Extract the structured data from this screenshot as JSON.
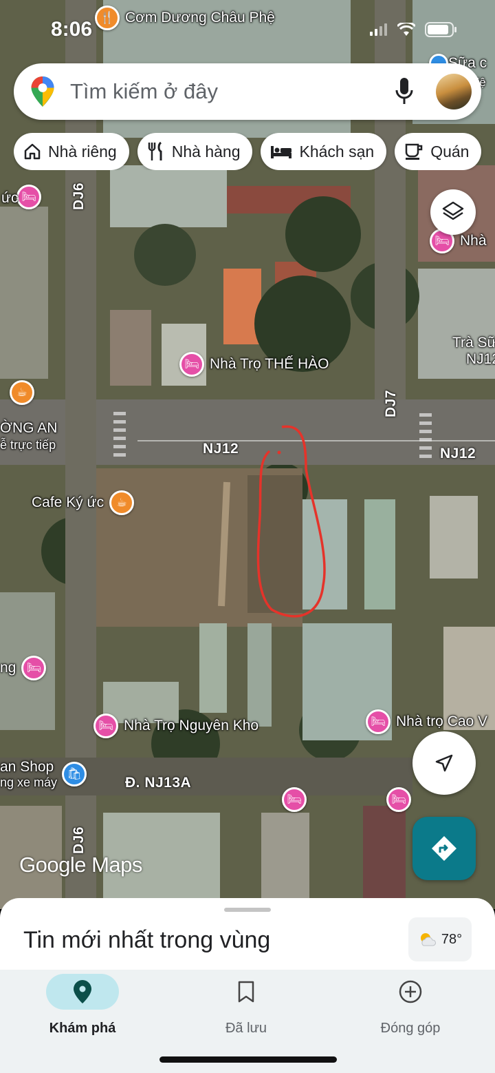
{
  "status_bar": {
    "time": "8:06"
  },
  "search": {
    "placeholder": "Tìm kiếm ở đây"
  },
  "chips": [
    {
      "label": "Nhà riêng",
      "icon": "home-icon"
    },
    {
      "label": "Nhà hàng",
      "icon": "restaurant-icon"
    },
    {
      "label": "Khách sạn",
      "icon": "hotel-icon"
    },
    {
      "label": "Quán",
      "icon": "cafe-icon"
    }
  ],
  "map": {
    "roads": {
      "dj6_top": "DJ6",
      "dj6_bottom": "DJ6",
      "dj7": "DJ7",
      "nj12_left": "NJ12",
      "nj12_right": "NJ12",
      "nj13a": "Đ. NJ13A"
    },
    "pois": {
      "top": "Cơm Dương Châu Phệ",
      "top_right": "Sữa c",
      "top_right_2": "hiệ",
      "left_hotel_1": "ức",
      "right_hotel_1": "Nhà",
      "the_hao": "Nhà Trọ THẾ HÀO",
      "tra_sua": "Trà Sữ",
      "tra_sua_2": "NJ12",
      "left_cafe_1": "ỜNG AN",
      "left_cafe_2": "ễ trực tiếp",
      "cafe_ky_uc": "Cafe Ký ức",
      "left_hotel_2": "ng",
      "nguyen_kho": "Nhà Trọ Nguyên Kho",
      "cao_v": "Nhà trọ Cao V",
      "shop_1": "an Shop",
      "shop_2": "ng xe máy"
    },
    "logo": {
      "google": "Google",
      "maps": "Maps"
    }
  },
  "sheet": {
    "title": "Tin mới nhất trong vùng",
    "weather": "78°"
  },
  "nav": [
    {
      "label": "Khám phá",
      "icon": "explore-pin-icon",
      "active": true
    },
    {
      "label": "Đã lưu",
      "icon": "bookmark-icon",
      "active": false
    },
    {
      "label": "Đóng góp",
      "icon": "add-circle-icon",
      "active": false
    }
  ]
}
